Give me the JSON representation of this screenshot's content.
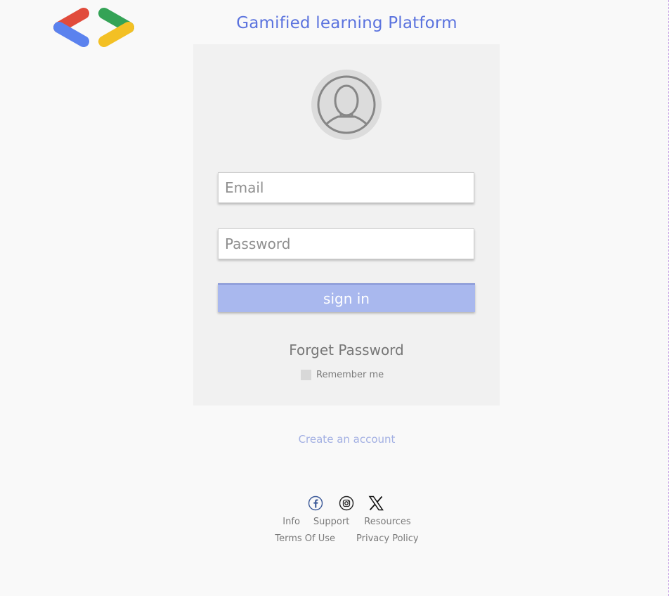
{
  "header": {
    "title": "Gamified learning Platform"
  },
  "login": {
    "email_placeholder": "Email",
    "password_placeholder": "Password",
    "signin_label": "sign in",
    "forget_password_label": "Forget Password",
    "remember_me_label": "Remember me"
  },
  "create_account_label": "Create an account",
  "footer": {
    "social_icons": [
      "facebook-icon",
      "instagram-icon",
      "x-icon"
    ],
    "links_row1": [
      "Info",
      "Support",
      "Resources"
    ],
    "links_row2": [
      "Terms Of Use",
      "Privacy Policy"
    ]
  },
  "colors": {
    "title": "#5b73de",
    "signin_button": "#a9b8ee",
    "create_account": "#a3b0e3",
    "card_background": "#f1f1f1",
    "logo_red": "#e14b3b",
    "logo_blue": "#5b82ee",
    "logo_green": "#34a356",
    "logo_yellow": "#f3c024"
  }
}
